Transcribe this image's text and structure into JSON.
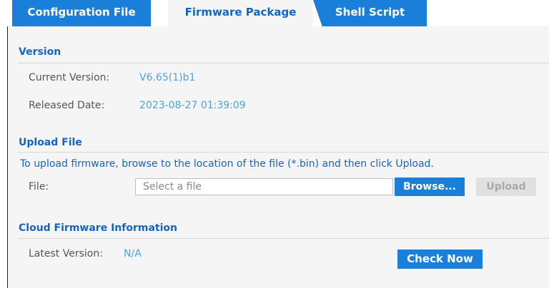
{
  "tabs": [
    {
      "label": "Configuration File",
      "active": false
    },
    {
      "label": "Firmware Package",
      "active": true
    },
    {
      "label": "Shell Script",
      "active": false
    }
  ],
  "version": {
    "title": "Version",
    "current_label": "Current Version:",
    "current_value": "V6.65(1)b1",
    "released_label": "Released Date:",
    "released_value": "2023-08-27 01:39:09"
  },
  "upload": {
    "title": "Upload File",
    "description": "To upload firmware, browse to the location of the file (*.bin) and then click Upload.",
    "file_label": "File:",
    "file_placeholder": "Select a file",
    "browse_label": "Browse...",
    "upload_label": "Upload"
  },
  "cloud": {
    "title": "Cloud Firmware Information",
    "latest_label": "Latest Version:",
    "latest_value": "N/A",
    "check_label": "Check Now"
  },
  "colors": {
    "accent": "#1a7fd8",
    "heading": "#1565c0",
    "value": "#4aa3df",
    "panel_bg": "#f5f5f5",
    "disabled_bg": "#e0e0e0"
  }
}
